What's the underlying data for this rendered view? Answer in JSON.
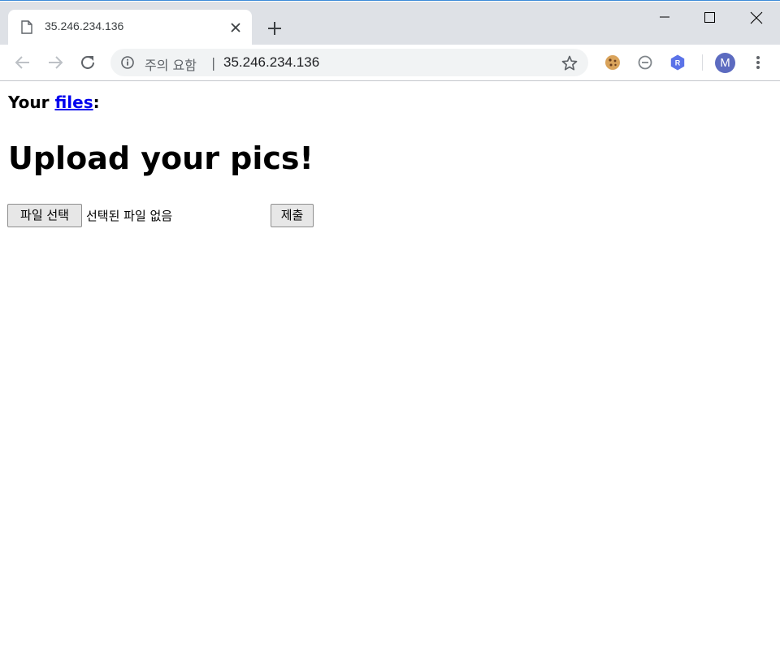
{
  "browser": {
    "tab": {
      "title": "35.246.234.136",
      "favicon": "document-icon"
    },
    "new_tab_icon": "plus-icon",
    "window_controls": [
      "minimize-icon",
      "maximize-icon",
      "close-icon"
    ],
    "toolbar": {
      "back_icon": "arrow-left-icon",
      "forward_icon": "arrow-right-icon",
      "reload_icon": "reload-icon",
      "omnibox": {
        "security_icon": "info-icon",
        "security_text": "주의 요함",
        "separator": "|",
        "url": "35.246.234.136",
        "bookmark_icon": "star-icon"
      },
      "extensions": [
        "cookie-icon",
        "block-icon",
        "hexagon-r-icon"
      ],
      "profile_initial": "M",
      "menu_icon": "kebab-menu-icon"
    }
  },
  "page": {
    "files_line": {
      "prefix": "Your ",
      "link": "files",
      "suffix": ":"
    },
    "heading": "Upload your pics!",
    "form": {
      "choose_file_label": "파일 선택",
      "no_file_text": "선택된 파일 없음",
      "submit_label": "제출"
    }
  },
  "colors": {
    "tabstrip": "#dee1e6",
    "link": "#0000ee",
    "avatar": "#5c6bc0",
    "extension_accent": "#5b73e8"
  }
}
